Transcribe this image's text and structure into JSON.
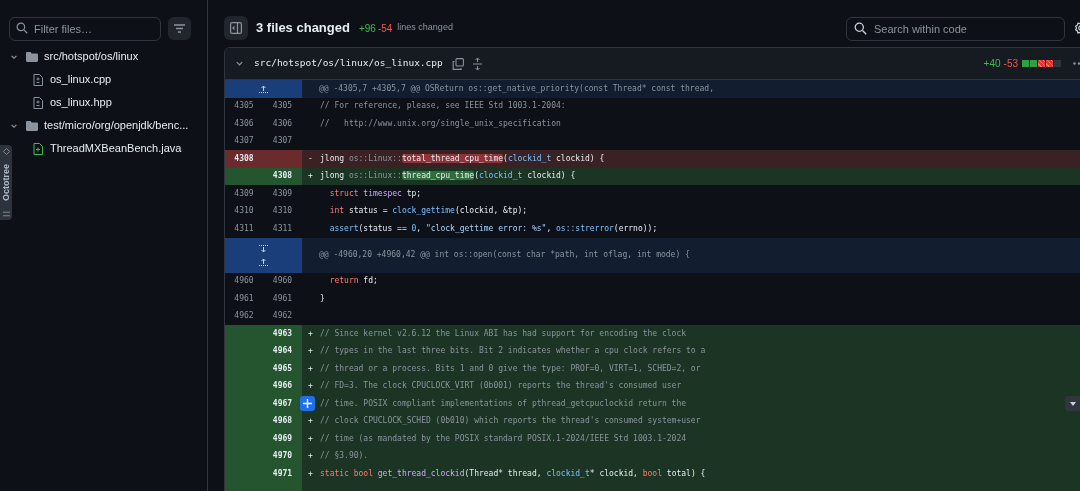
{
  "sidebar": {
    "filter": {
      "placeholder": "Filter files…"
    },
    "tree": [
      {
        "kind": "folder",
        "label": "src/hotspot/os/linux",
        "expanded": true,
        "children": [
          {
            "kind": "file",
            "label": "os_linux.cpp",
            "added": false
          },
          {
            "kind": "file",
            "label": "os_linux.hpp",
            "added": false
          }
        ]
      },
      {
        "kind": "folder",
        "label": "test/micro/org/openjdk/benc...",
        "expanded": true,
        "children": [
          {
            "kind": "file",
            "label": "ThreadMXBeanBench.java",
            "added": true
          }
        ]
      }
    ]
  },
  "extension_tab": {
    "label": "Octotree"
  },
  "header": {
    "title": "3 files changed",
    "additions": "+96",
    "deletions": "-54",
    "caption": "lines changed",
    "search": {
      "placeholder": "Search within code"
    }
  },
  "file": {
    "path": "src/hotspot/os/linux/os_linux.cpp",
    "expanded": true,
    "additions": "+40",
    "deletions": "-53",
    "diffstat": [
      {
        "kind": "added"
      },
      {
        "kind": "added"
      },
      {
        "kind": "deleted"
      },
      {
        "kind": "deleted"
      },
      {
        "kind": "neutral"
      }
    ],
    "rows": [
      {
        "kind": "hunk",
        "expand_up": true,
        "expand_down": false,
        "text": "@@ -4305,7 +4305,7 @@ OSReturn os::get_native_priority(const Thread* const thread,"
      },
      {
        "kind": "context",
        "old": "4305",
        "new": "4305",
        "hovered": false,
        "code": [
          {
            "kind": "comment",
            "text": "// For reference, please, see IEEE Std 1003.1-2004:"
          }
        ]
      },
      {
        "kind": "context",
        "old": "4306",
        "new": "4306",
        "hovered": false,
        "code": [
          {
            "kind": "comment",
            "text": "//   http://www.unix.org/single_unix_specification"
          }
        ]
      },
      {
        "kind": "context",
        "old": "4307",
        "new": "4307",
        "hovered": false
      },
      {
        "kind": "del",
        "old": "4308",
        "marker": "-",
        "hovered": false,
        "code": [
          {
            "kind": "plain",
            "text": "jlong "
          },
          {
            "kind": "namespace",
            "text": "os::Linux::"
          },
          {
            "kind": "highlight",
            "text": "total_thread_cpu_time"
          },
          {
            "kind": "plain",
            "text": "("
          },
          {
            "kind": "type",
            "text": "clockid_t"
          },
          {
            "kind": "plain",
            "text": " clockid) {"
          }
        ]
      },
      {
        "kind": "add",
        "new": "4308",
        "marker": "+",
        "hovered": false,
        "code": [
          {
            "kind": "plain",
            "text": "jlong "
          },
          {
            "kind": "namespace",
            "text": "os::Linux::"
          },
          {
            "kind": "highlight",
            "text": "thread_cpu_time"
          },
          {
            "kind": "plain",
            "text": "("
          },
          {
            "kind": "type",
            "text": "clockid_t"
          },
          {
            "kind": "plain",
            "text": " clockid) {"
          }
        ]
      },
      {
        "kind": "context",
        "old": "4309",
        "new": "4309",
        "hovered": false,
        "code": [
          {
            "kind": "keyword",
            "text": "  struct "
          },
          {
            "kind": "function",
            "text": "timespec"
          },
          {
            "kind": "plain",
            "text": " tp;"
          }
        ]
      },
      {
        "kind": "context",
        "old": "4310",
        "new": "4310",
        "hovered": false,
        "code": [
          {
            "kind": "keyword",
            "text": "  int"
          },
          {
            "kind": "plain",
            "text": " status = "
          },
          {
            "kind": "type",
            "text": "clock_gettime"
          },
          {
            "kind": "plain",
            "text": "(clockid, &tp);"
          }
        ]
      },
      {
        "kind": "context",
        "old": "4311",
        "new": "4311",
        "hovered": false,
        "code": [
          {
            "kind": "type",
            "text": "  assert"
          },
          {
            "kind": "plain",
            "text": "(status == "
          },
          {
            "kind": "type",
            "text": "0"
          },
          {
            "kind": "plain",
            "text": ", "
          },
          {
            "kind": "string",
            "text": "\"clock_gettime error: %s\""
          },
          {
            "kind": "plain",
            "text": ", "
          },
          {
            "kind": "type",
            "text": "os::strerror"
          },
          {
            "kind": "plain",
            "text": "(errno));"
          }
        ]
      },
      {
        "kind": "hunk",
        "expand_up": true,
        "expand_down": true,
        "text": "@@ -4960,20 +4960,42 @@ int os::open(const char *path, int oflag, int mode) {"
      },
      {
        "kind": "context",
        "old": "4960",
        "new": "4960",
        "hovered": false,
        "code": [
          {
            "kind": "keyword",
            "text": "  return"
          },
          {
            "kind": "plain",
            "text": " fd;"
          }
        ]
      },
      {
        "kind": "context",
        "old": "4961",
        "new": "4961",
        "hovered": false,
        "code": [
          {
            "kind": "plain",
            "text": "}"
          }
        ]
      },
      {
        "kind": "context",
        "old": "4962",
        "new": "4962",
        "hovered": false
      },
      {
        "kind": "add",
        "new": "4963",
        "marker": "+",
        "hovered": false,
        "code": [
          {
            "kind": "comment",
            "text": "// Since kernel v2.6.12 the Linux ABI has had support for encoding the clock"
          }
        ]
      },
      {
        "kind": "add",
        "new": "4964",
        "marker": "+",
        "hovered": false,
        "code": [
          {
            "kind": "comment",
            "text": "// types in the last three bits. Bit 2 indicates whether a cpu clock refers to a"
          }
        ]
      },
      {
        "kind": "add",
        "new": "4965",
        "marker": "+",
        "hovered": false,
        "code": [
          {
            "kind": "comment",
            "text": "// thread or a process. Bits 1 and 0 give the type: PROF=0, VIRT=1, SCHED=2, or"
          }
        ]
      },
      {
        "kind": "add",
        "new": "4966",
        "marker": "+",
        "hovered": false,
        "code": [
          {
            "kind": "comment",
            "text": "// FD=3. The clock CPUCLOCK_VIRT (0b001) reports the thread's consumed user"
          }
        ]
      },
      {
        "kind": "add",
        "new": "4967",
        "hovered": true,
        "code": [
          {
            "kind": "comment",
            "text": "// time. POSIX compliant implementations of pthread_getcpuclockid return the"
          }
        ]
      },
      {
        "kind": "add",
        "new": "4968",
        "marker": "+",
        "hovered": false,
        "code": [
          {
            "kind": "comment",
            "text": "// clock CPUCLOCK_SCHED (0b010) which reports the thread's consumed system+user"
          }
        ]
      },
      {
        "kind": "add",
        "new": "4969",
        "marker": "+",
        "hovered": false,
        "code": [
          {
            "kind": "comment",
            "text": "// time (as mandated by the POSIX standard POSIX.1-2024/IEEE Std 1003.1-2024"
          }
        ]
      },
      {
        "kind": "add",
        "new": "4970",
        "marker": "+",
        "hovered": false,
        "code": [
          {
            "kind": "comment",
            "text": "// §3.90)."
          }
        ]
      },
      {
        "kind": "add",
        "new": "4971",
        "marker": "+",
        "hovered": false,
        "code": [
          {
            "kind": "keyword",
            "text": "static bool "
          },
          {
            "kind": "function",
            "text": "get_thread_clockid"
          },
          {
            "kind": "plain",
            "text": "(Thread* thread, "
          },
          {
            "kind": "type",
            "text": "clockid_t"
          },
          {
            "kind": "plain",
            "text": "* clockid, "
          },
          {
            "kind": "keyword",
            "text": "bool"
          },
          {
            "kind": "plain",
            "text": " total) {"
          }
        ]
      }
    ]
  }
}
